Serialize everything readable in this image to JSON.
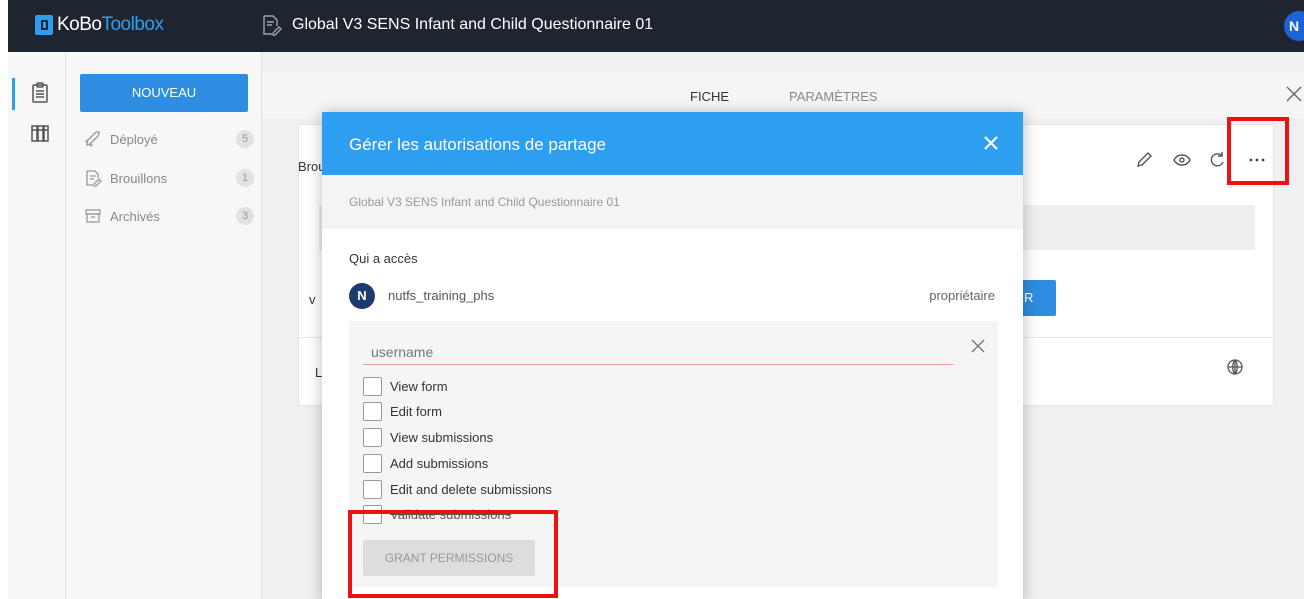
{
  "app": {
    "logo_prefix": "KoBo",
    "logo_suffix": "Toolbox",
    "page_title": "Global V3 SENS Infant and Child Questionnaire 01",
    "user_initial": "N"
  },
  "sidebar": {
    "new_button": "NOUVEAU",
    "items": [
      {
        "label": "Déployé",
        "count": "5",
        "icon": "rocket-icon"
      },
      {
        "label": "Brouillons",
        "count": "1",
        "icon": "draft-icon"
      },
      {
        "label": "Archivés",
        "count": "3",
        "icon": "archive-icon"
      }
    ]
  },
  "tabs": [
    {
      "label": "FICHE",
      "active": true
    },
    {
      "label": "PARAMÈTRES",
      "active": false
    }
  ],
  "card": {
    "label_top": "Brou",
    "label_mid": "v",
    "label_bottom": "L",
    "deploy_button": "DÉPLOYER"
  },
  "modal": {
    "title": "Gérer les autorisations de partage",
    "subtitle": "Global V3 SENS Infant and Child Questionnaire 01",
    "access_label": "Qui a accès",
    "owner": {
      "initial": "N",
      "name": "nutfs_training_phs",
      "role": "propriétaire"
    },
    "username_placeholder": "username",
    "permissions": [
      "View form",
      "Edit form",
      "View submissions",
      "Add submissions",
      "Edit and delete submissions",
      "Validate submissions"
    ],
    "grant_button": "GRANT PERMISSIONS"
  },
  "colors": {
    "topbar": "#1f2530",
    "accent": "#2e9ef0",
    "button": "#2e8de0",
    "highlight": "#ee1111"
  }
}
